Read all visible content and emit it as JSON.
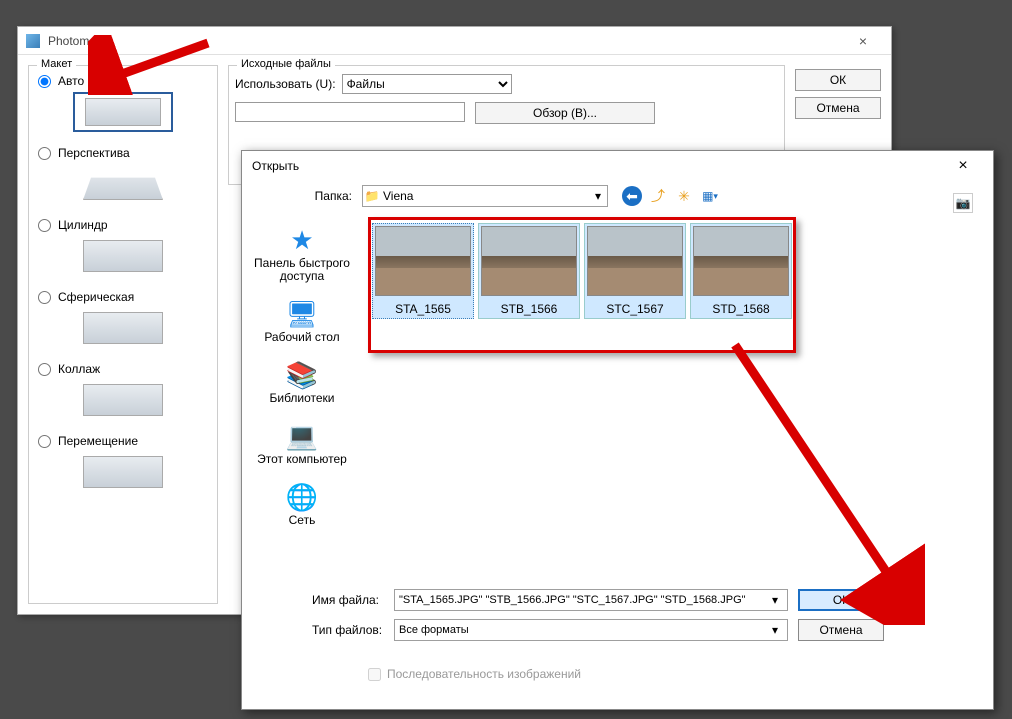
{
  "photomerge": {
    "title": "Photomerge",
    "close_x": "×",
    "layout_legend": "Макет",
    "options": {
      "auto": "Авто",
      "perspective": "Перспектива",
      "cylinder": "Цилиндр",
      "spherical": "Сферическая",
      "collage": "Коллаж",
      "reposition": "Перемещение"
    },
    "sources_legend": "Исходные файлы",
    "use_label": "Использовать (U):",
    "use_value": "Файлы",
    "browse_label": "Обзор (B)...",
    "ok": "ОК",
    "cancel": "Отмена"
  },
  "open": {
    "title": "Открыть",
    "close_x": "×",
    "folder_label": "Папка:",
    "folder_name": "Viena",
    "view_star": "📷",
    "places": {
      "quick": "Панель быстрого доступа",
      "desktop": "Рабочий стол",
      "libraries": "Библиотеки",
      "thispc": "Этот компьютер",
      "network": "Сеть"
    },
    "thumbs": [
      "STA_1565",
      "STB_1566",
      "STC_1567",
      "STD_1568"
    ],
    "filename_label": "Имя файла:",
    "filename_value": "\"STA_1565.JPG\" \"STB_1566.JPG\" \"STC_1567.JPG\" \"STD_1568.JPG\"",
    "filetype_label": "Тип файлов:",
    "filetype_value": "Все форматы",
    "ok": "ОК",
    "cancel": "Отмена",
    "sequence": "Последовательность изображений"
  },
  "icons": {
    "folder": "📁",
    "back": "⬅",
    "up": "⤴",
    "new": "✳",
    "view": "▦",
    "dropdown": "▾",
    "star": "★",
    "desktop": "🖥",
    "lib": "📚",
    "pc": "💻",
    "net": "🌐"
  }
}
